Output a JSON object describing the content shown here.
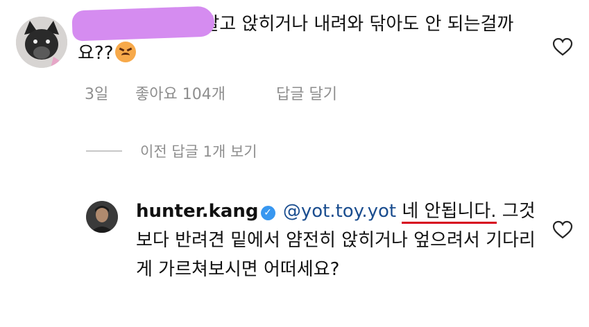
{
  "comment1": {
    "avatar_icon": "dog-avatar-icon",
    "text_visible": "을 깔고 앉히거나 내려와 닦아도 안 되는걸까요??",
    "emoji": "persevering-face-emoji",
    "time": "3일",
    "likes": "좋아요 104개",
    "reply": "답글 달기"
  },
  "view_replies": "이전 답글 1개 보기",
  "comment2": {
    "username": "hunter.kang",
    "mention": "@yot.toy.yot",
    "text_part1": "네 안됩니",
    "text_part2": "다.",
    "text_rest": "그것보다 반려견 밑에서 얌전히 앉히거나 엎으려서 기다리게 가르쳐보시면 어떠세요?"
  },
  "colors": {
    "redaction": "#d58cf0",
    "verified": "#3897f0",
    "mention": "#1a4d8f",
    "underline": "#d6001c",
    "meta": "#8e8e8e"
  }
}
